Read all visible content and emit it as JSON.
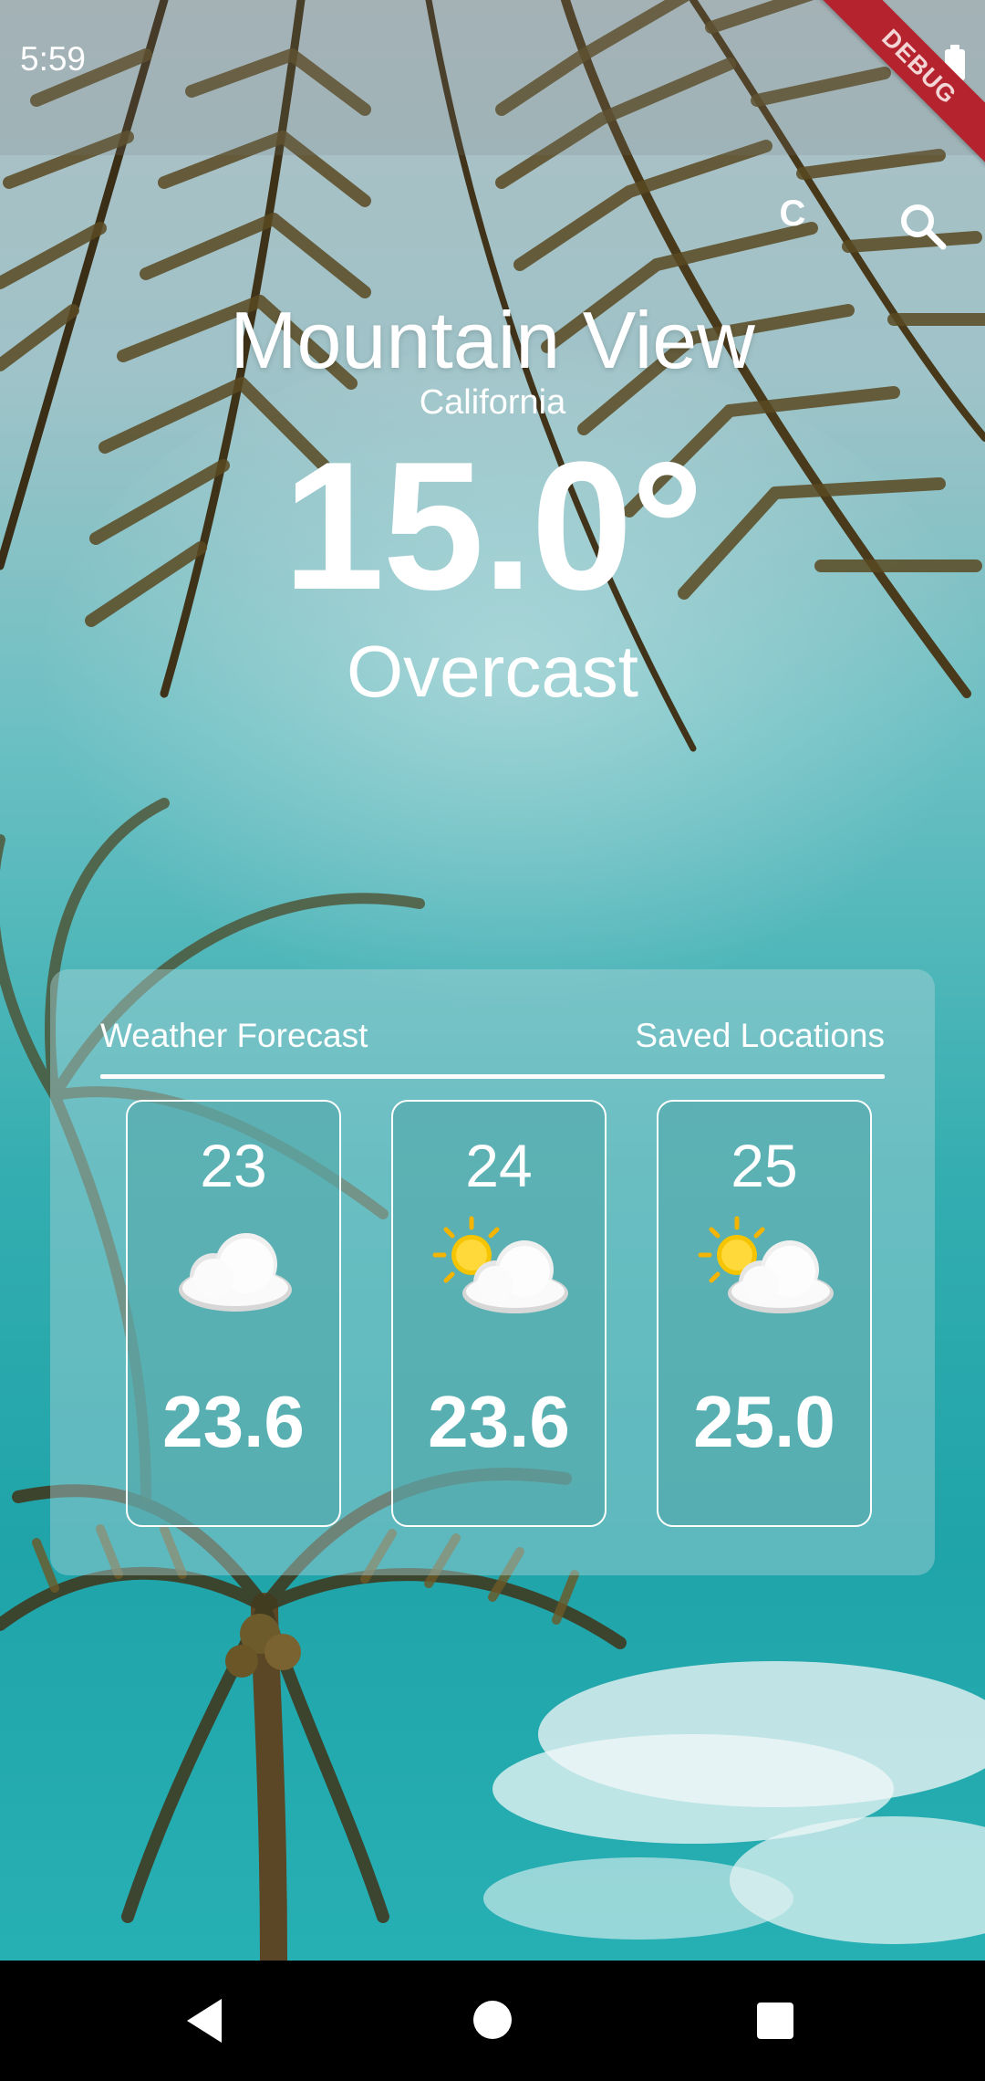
{
  "status_bar": {
    "time": "5:59",
    "debug_label": "DEBUG"
  },
  "toolbar": {
    "unit_label": "C",
    "search_icon": "search-icon"
  },
  "current": {
    "city": "Mountain View",
    "region": "California",
    "temperature": "15.0°",
    "condition": "Overcast"
  },
  "tabs": [
    {
      "label": "Weather Forecast",
      "selected": true
    },
    {
      "label": "Saved Locations",
      "selected": false
    }
  ],
  "forecast": [
    {
      "day": "23",
      "icon": "cloud-icon",
      "temp": "23.6"
    },
    {
      "day": "24",
      "icon": "partly-cloudy-icon",
      "temp": "23.6"
    },
    {
      "day": "25",
      "icon": "partly-cloudy-icon",
      "temp": "25.0"
    }
  ],
  "navigation": {
    "back": "back-icon",
    "home": "home-icon",
    "recents": "recents-icon"
  }
}
